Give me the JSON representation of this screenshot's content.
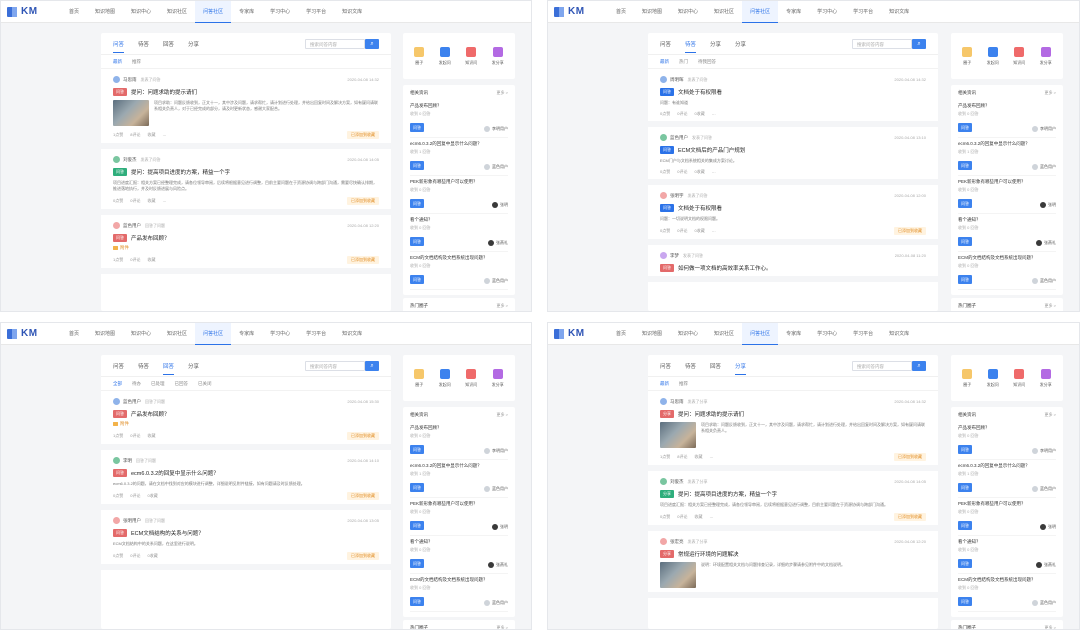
{
  "app": {
    "logo": "KM"
  },
  "nav": [
    "首页",
    "知识地图",
    "知识中心",
    "知识社区",
    "问答社区",
    "专家库",
    "学习中心",
    "学习平台",
    "知识文库"
  ],
  "active_nav_index": 4,
  "panels": [
    {
      "tabs": [
        "问答",
        "待答",
        "回答",
        "分享"
      ],
      "active_tab": 0,
      "search_placeholder": "搜索问答内容",
      "subtabs": [
        "最新",
        "推荐"
      ],
      "active_subtab": 0,
      "posts": [
        {
          "author": "马思雨",
          "meta": "发表了问答",
          "date": "2020-04-08 14:32",
          "badge": "问答",
          "badge_color": "#e36a6a",
          "title": "提问：问题求助的提示请们",
          "has_image": true,
          "text": "项目求助：问题反馈收到，正文十一，其中涉及问题，请求帮忙，请计划进行处理，并给出回复时间及解决方案，如有疑问请联系相关负责人，对于已经完成的部分，请及时更新状态，感谢大家配合。",
          "attach": "",
          "foot": [
            "1点赞",
            "8评论",
            "收藏",
            "···"
          ],
          "hl": "已添加到收藏"
        },
        {
          "author": "刘俊杰",
          "meta": "发表了问答",
          "date": "2020-04-08 14:05",
          "badge": "问答",
          "badge_color": "#2fae7c",
          "title": "提问：提高项目进度的方案，精益一个字",
          "has_image": false,
          "text": "项目进度汇报：相关方案已经整理完成，请各位领导审阅，后续将根据意见进行调整，目前主要问题在于资源协调与跨部门沟通，需要尽快确认排期，推进落地执行，并及时反馈进展与风险点。",
          "attach": "",
          "foot": [
            "0点赞",
            "0评论",
            "收藏",
            "···"
          ],
          "hl": "已添加到收藏"
        },
        {
          "author": "蓝色用户",
          "meta": "回答了问题",
          "date": "2020-04-08 12:20",
          "badge": "问答",
          "badge_color": "#e36a6a",
          "title": "产品发布回顾？",
          "has_image": false,
          "text": "",
          "attach": "附件",
          "foot": [
            "1点赞",
            "0评论",
            "收藏"
          ],
          "hl": "已添加到收藏"
        }
      ],
      "quick": [
        {
          "label": "圈子",
          "color": "#f6c76a"
        },
        {
          "label": "发起问",
          "color": "#3c82ee"
        },
        {
          "label": "知识问",
          "color": "#ef6a6a"
        },
        {
          "label": "发分享",
          "color": "#b36ae3"
        }
      ],
      "side_title": "相关资讯",
      "side_more": "更多 >",
      "side_items": [
        {
          "q": "产品发布回顾？",
          "s": "收到 0 回答",
          "btn": "问答",
          "user": "李明用户",
          "dark": false
        },
        {
          "q": "ecm6.0.3.2的回复中显示什么问题？",
          "s": "收到 1 回答",
          "btn": "问答",
          "user": "蓝色用户",
          "dark": false
        },
        {
          "q": "PEK新形象有哪些用户可以使用？",
          "s": "收到 0 回答",
          "btn": "问答",
          "user": "张明",
          "dark": true
        },
        {
          "q": "看个通知？",
          "s": "收到 0 回答",
          "btn": "问答",
          "user": "张燕礼",
          "dark": true
        },
        {
          "q": "ECM的文档结构及文档系统出现问题？",
          "s": "收到 0 回答",
          "btn": "问答",
          "user": "蓝色用户",
          "dark": false
        }
      ],
      "hot_title": "热门圈子"
    },
    {
      "tabs": [
        "问答",
        "待答",
        "分享",
        "分享"
      ],
      "active_tab": 1,
      "search_placeholder": "搜索问答内容",
      "subtabs": [
        "最新",
        "热门",
        "待我回答"
      ],
      "active_subtab": 0,
      "posts": [
        {
          "author": "周明晖",
          "meta": "发表了问答",
          "date": "2020-04-08 14:32",
          "badge": "问答",
          "badge_color": "#2b72e8",
          "title": "文档处于有权限看",
          "has_image": false,
          "text": "问题：有谁知道",
          "attach": "",
          "foot": [
            "0点赞",
            "0评论",
            "0收藏",
            "···"
          ],
          "hl": ""
        },
        {
          "author": "蓝色用户",
          "meta": "发表了问答",
          "date": "2020-04-08 13:10",
          "badge": "问答",
          "badge_color": "#2b72e8",
          "title": "ECM文档后的产品门户规划",
          "has_image": false,
          "text": "ECM门户与文档系统相关的集成方案讨论。",
          "attach": "",
          "foot": [
            "0点赞",
            "0评论",
            "0收藏",
            "···"
          ],
          "hl": ""
        },
        {
          "author": "张明宇",
          "meta": "发表了问答",
          "date": "2020-04-08 12:00",
          "badge": "问答",
          "badge_color": "#2b72e8",
          "title": "文档处于有权限看",
          "has_image": false,
          "text": "问题：一切说明文档的权限问题。",
          "attach": "",
          "foot": [
            "0点赞",
            "0评论",
            "0收藏",
            "···"
          ],
          "hl": "已添加到收藏"
        },
        {
          "author": "李梦",
          "meta": "发表了问答",
          "date": "2020-04-08 11:20",
          "badge": "问答",
          "badge_color": "#e36a6a",
          "title": "如何做一项文档的高效率关系工作心。",
          "has_image": false,
          "text": "",
          "attach": "",
          "foot": [],
          "hl": ""
        }
      ],
      "quick": [
        {
          "label": "圈子",
          "color": "#f6c76a"
        },
        {
          "label": "发起问",
          "color": "#3c82ee"
        },
        {
          "label": "知识问",
          "color": "#ef6a6a"
        },
        {
          "label": "发分享",
          "color": "#b36ae3"
        }
      ],
      "side_title": "相关资讯",
      "side_more": "更多 >",
      "side_items": [
        {
          "q": "产品发布回顾？",
          "s": "收到 0 回答",
          "btn": "问答",
          "user": "李明用户",
          "dark": false
        },
        {
          "q": "ecm6.0.3.2的回复中显示什么问题？",
          "s": "收到 1 回答",
          "btn": "问答",
          "user": "蓝色用户",
          "dark": false
        },
        {
          "q": "PEK新形象有哪些用户可以使用？",
          "s": "收到 0 回答",
          "btn": "问答",
          "user": "张明",
          "dark": true
        },
        {
          "q": "看个通知？",
          "s": "收到 0 回答",
          "btn": "问答",
          "user": "张燕礼",
          "dark": true
        },
        {
          "q": "ECM的文档结构及文档系统出现问题？",
          "s": "收到 0 回答",
          "btn": "问答",
          "user": "蓝色用户",
          "dark": false
        }
      ],
      "hot_title": "热门圈子"
    },
    {
      "tabs": [
        "问答",
        "待答",
        "回答",
        "分享"
      ],
      "active_tab": 2,
      "search_placeholder": "搜索问答内容",
      "subtabs": [
        "全部",
        "待办",
        "已处理",
        "已回答",
        "已关闭"
      ],
      "active_subtab": 0,
      "posts": [
        {
          "author": "蓝色用户",
          "meta": "回答了问题",
          "date": "2020-04-08 15:30",
          "badge": "问答",
          "badge_color": "#e36a6a",
          "title": "产品发布回顾？",
          "has_image": false,
          "text": "",
          "attach": "附件",
          "foot": [
            "1点赞",
            "0评论",
            "收藏"
          ],
          "hl": "已添加到收藏"
        },
        {
          "author": "李明",
          "meta": "回答了问题",
          "date": "2020-04-08 14:10",
          "badge": "问答",
          "badge_color": "#e36a6a",
          "title": "ecm6.0.3.2的回复中显示什么问题？",
          "has_image": false,
          "text": "ecm6.0.3.2的问题，请在文档中找到对应的模块进行调整，详细说明见附件链接，如有问题请及时反馈处理。",
          "attach": "",
          "foot": [
            "0点赞",
            "0评论",
            "0收藏"
          ],
          "hl": "已添加到收藏"
        },
        {
          "author": "张明用户",
          "meta": "回答了问题",
          "date": "2020-04-08 13:05",
          "badge": "问答",
          "badge_color": "#e36a6a",
          "title": "ECM文档结构的关系与问题？",
          "has_image": false,
          "text": "ECM文档结构中的关系问题，在这里进行说明。",
          "attach": "",
          "foot": [
            "0点赞",
            "0评论",
            "0收藏"
          ],
          "hl": "已添加到收藏"
        }
      ],
      "quick": [
        {
          "label": "圈子",
          "color": "#f6c76a"
        },
        {
          "label": "发起问",
          "color": "#3c82ee"
        },
        {
          "label": "知识问",
          "color": "#ef6a6a"
        },
        {
          "label": "发分享",
          "color": "#b36ae3"
        }
      ],
      "side_title": "相关资讯",
      "side_more": "更多 >",
      "side_items": [
        {
          "q": "产品发布回顾？",
          "s": "收到 0 回答",
          "btn": "问答",
          "user": "李明用户",
          "dark": false
        },
        {
          "q": "ecm6.0.3.2的回复中显示什么问题？",
          "s": "收到 1 回答",
          "btn": "问答",
          "user": "蓝色用户",
          "dark": false
        },
        {
          "q": "PEK新形象有哪些用户可以使用？",
          "s": "收到 0 回答",
          "btn": "问答",
          "user": "张明",
          "dark": true
        },
        {
          "q": "看个通知？",
          "s": "收到 0 回答",
          "btn": "问答",
          "user": "张燕礼",
          "dark": true
        },
        {
          "q": "ECM的文档结构及文档系统出现问题？",
          "s": "收到 0 回答",
          "btn": "问答",
          "user": "蓝色用户",
          "dark": false
        }
      ],
      "hot_title": "热门圈子"
    },
    {
      "tabs": [
        "问答",
        "待答",
        "回答",
        "分享"
      ],
      "active_tab": 3,
      "search_placeholder": "搜索问答内容",
      "subtabs": [
        "最新",
        "推荐"
      ],
      "active_subtab": 0,
      "posts": [
        {
          "author": "马思雨",
          "meta": "发表了分享",
          "date": "2020-04-08 14:32",
          "badge": "分享",
          "badge_color": "#e36a6a",
          "title": "提问：问题求助的提示请们",
          "has_image": true,
          "text": "项目求助：问题反馈收到，正文十一，其中涉及问题，请求帮忙，请计划进行处理，并给出回复时间及解决方案，如有疑问请联系相关负责人。",
          "attach": "",
          "foot": [
            "1点赞",
            "8评论",
            "收藏",
            "···"
          ],
          "hl": "已添加到收藏"
        },
        {
          "author": "刘俊杰",
          "meta": "发表了分享",
          "date": "2020-04-08 14:05",
          "badge": "分享",
          "badge_color": "#2fae7c",
          "title": "提问：提高项目进度的方案，精益一个字",
          "has_image": false,
          "text": "项目进度汇报：相关方案已经整理完成，请各位领导审阅，后续将根据意见进行调整，目前主要问题在于资源协调与跨部门沟通。",
          "attach": "",
          "foot": [
            "0点赞",
            "0评论",
            "收藏",
            "···"
          ],
          "hl": "已添加到收藏"
        },
        {
          "author": "张宏亮",
          "meta": "发表了分享",
          "date": "2020-04-08 12:20",
          "badge": "分享",
          "badge_color": "#e36a6a",
          "title": "常规运行环境的问题解决",
          "has_image": true,
          "text": "说明：环境配置相关文档与问题排查记录，详细的步骤请参见附件中的文档说明。",
          "attach": "",
          "foot": [],
          "hl": ""
        }
      ],
      "quick": [
        {
          "label": "圈子",
          "color": "#f6c76a"
        },
        {
          "label": "发起问",
          "color": "#3c82ee"
        },
        {
          "label": "知识问",
          "color": "#ef6a6a"
        },
        {
          "label": "发分享",
          "color": "#b36ae3"
        }
      ],
      "side_title": "相关资讯",
      "side_more": "更多 >",
      "side_items": [
        {
          "q": "产品发布回顾？",
          "s": "收到 0 回答",
          "btn": "问答",
          "user": "李明用户",
          "dark": false
        },
        {
          "q": "ecm6.0.3.2的回复中显示什么问题？",
          "s": "收到 1 回答",
          "btn": "问答",
          "user": "蓝色用户",
          "dark": false
        },
        {
          "q": "PEK新形象有哪些用户可以使用？",
          "s": "收到 0 回答",
          "btn": "问答",
          "user": "张明",
          "dark": true
        },
        {
          "q": "看个通知？",
          "s": "收到 0 回答",
          "btn": "问答",
          "user": "张燕礼",
          "dark": true
        },
        {
          "q": "ECM的文档结构及文档系统出现问题？",
          "s": "收到 0 回答",
          "btn": "问答",
          "user": "蓝色用户",
          "dark": false
        }
      ],
      "hot_title": "热门圈子"
    }
  ]
}
